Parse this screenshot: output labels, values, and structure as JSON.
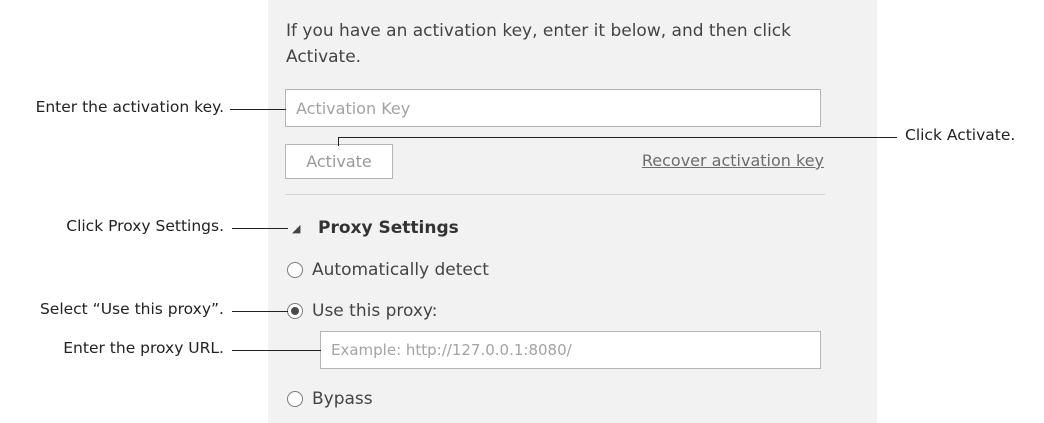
{
  "activation": {
    "intro_text": "If you have an activation key, enter it below, and then click Activate.",
    "key_placeholder": "Activation Key",
    "activate_label": "Activate",
    "recover_label": "Recover activation key"
  },
  "proxy": {
    "section_title": "Proxy Settings",
    "options": [
      {
        "label": "Automatically detect",
        "selected": false
      },
      {
        "label": "Use this proxy:",
        "selected": true
      },
      {
        "label": "Bypass",
        "selected": false
      }
    ],
    "url_placeholder": "Example: http://127.0.0.1:8080/"
  },
  "callouts": {
    "enter_key": "Enter the activation key.",
    "click_activate": "Click Activate.",
    "click_proxy": "Click Proxy Settings.",
    "select_proxy": "Select “Use this proxy”.",
    "enter_url": "Enter the proxy URL."
  }
}
